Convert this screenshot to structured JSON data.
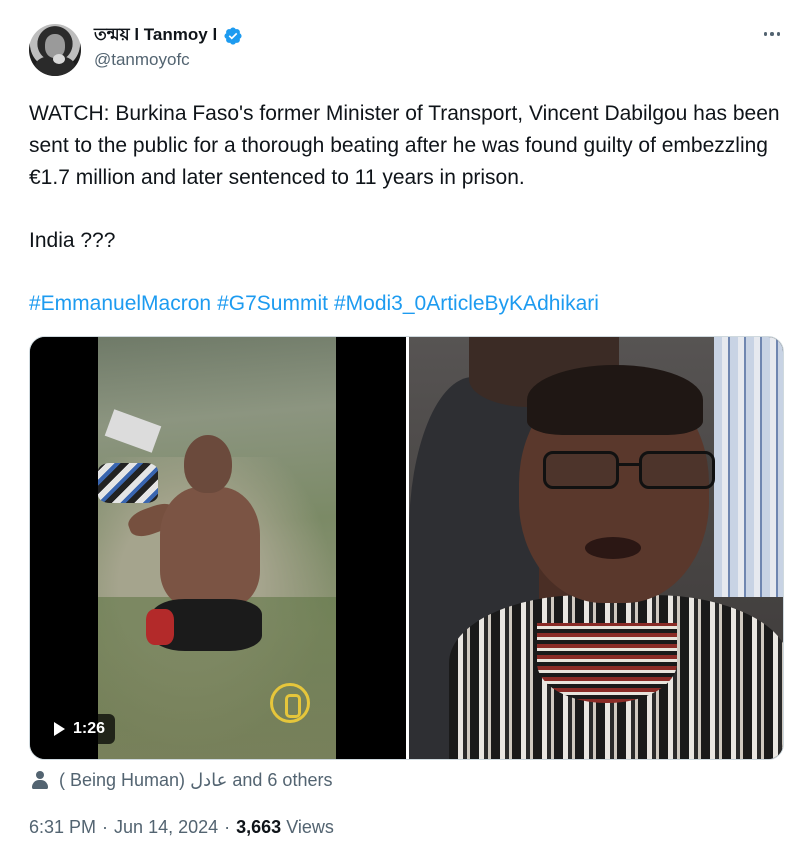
{
  "author": {
    "display_name": "তন্ময় l Tanmoy l",
    "handle": "@tanmoyofc",
    "verified_color": "#1d9bf0"
  },
  "tweet": {
    "paragraph_1": "WATCH: Burkina Faso's former Minister of Transport, Vincent Dabilgou has been sent to the public for a thorough beating after he was found guilty of embezzling €1.7 million and later sentenced to 11 years in prison.",
    "paragraph_2": "India ???",
    "hashtags": [
      "#EmmanuelMacron",
      "#G7Summit",
      "#Modi3_0ArticleByKAdhikari"
    ]
  },
  "media": {
    "video_duration": "1:26"
  },
  "likes": {
    "text": "( Being Human) عادل and 6 others"
  },
  "meta": {
    "time": "6:31 PM",
    "date": "Jun 14, 2024",
    "separator": "·",
    "views_count": "3,663",
    "views_label": "Views"
  },
  "colors": {
    "link": "#1d9bf0",
    "secondary_text": "#536471",
    "primary_text": "#0f1419"
  }
}
